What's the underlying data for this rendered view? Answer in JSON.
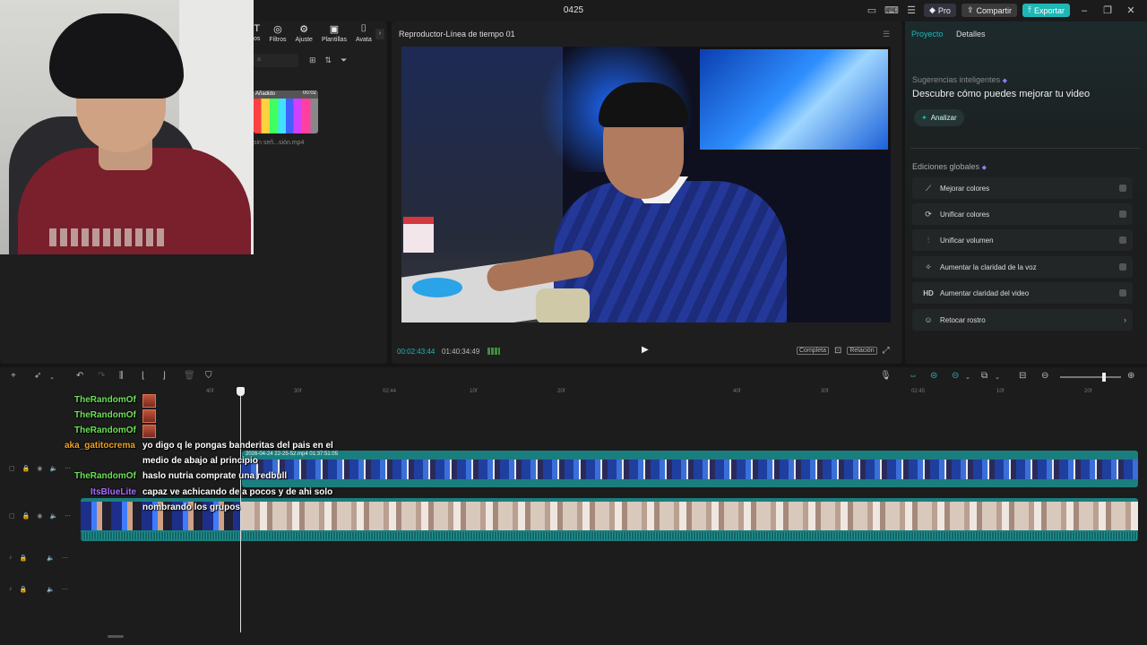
{
  "titlebar": {
    "title": "0425",
    "pro_label": "Pro",
    "share_label": "Compartir",
    "export_label": "Exportar"
  },
  "media_panel": {
    "tools": [
      {
        "label": "os",
        "icon": "text-icon"
      },
      {
        "label": "Filtros",
        "icon": "filters-icon"
      },
      {
        "label": "Ajuste",
        "icon": "adjust-icon"
      },
      {
        "label": "Plantillas",
        "icon": "templates-icon"
      },
      {
        "label": "Avata",
        "icon": "avatar-icon"
      }
    ],
    "search_placeholder": "a",
    "thumb_label": "Añadido",
    "thumb_duration": "00:02",
    "file_name": "sin señ...sión.mp4"
  },
  "player": {
    "title": "Reproductor-Línea de tiempo 01",
    "current_time": "00:02:43:44",
    "total_time": "01:40:34:49",
    "completa_label": "Completa",
    "relacion_label": "Relación"
  },
  "right_panel": {
    "tabs": [
      "Proyecto",
      "Detalles"
    ],
    "suggestions_label": "Sugerencias inteligentes",
    "suggestions_title": "Descubre cómo puedes mejorar tu video",
    "analyze_label": "Analizar",
    "global_label": "Ediciones globales",
    "global_items": [
      {
        "label": "Mejorar colores",
        "icon": "magic-wand-icon",
        "control": "toggle"
      },
      {
        "label": "Unificar colores",
        "icon": "color-match-icon",
        "control": "toggle"
      },
      {
        "label": "Unificar volumen",
        "icon": "volume-sliders-icon",
        "control": "toggle"
      },
      {
        "label": "Aumentar la claridad de la voz",
        "icon": "voice-clarity-icon",
        "control": "toggle"
      },
      {
        "label": "Aumentar claridad del video",
        "icon": "hd-icon",
        "control": "toggle"
      },
      {
        "label": "Retocar rostro",
        "icon": "face-retouch-icon",
        "control": "chevron"
      }
    ]
  },
  "timeline": {
    "ruler_labels": [
      "40f",
      "30f",
      "02:44",
      "10f",
      "20f",
      "40f",
      "30f",
      "02:45",
      "10f",
      "20f"
    ],
    "clip1_info": "2026-04-24 22-25-52.mp4   01:37:51:05"
  },
  "chat": [
    {
      "user": "TheRandomOf",
      "color": "green",
      "message": ""
    },
    {
      "user": "TheRandomOf",
      "color": "green",
      "message": ""
    },
    {
      "user": "TheRandomOf",
      "color": "green",
      "message": ""
    },
    {
      "user": "aka_gatitocrema",
      "color": "orange",
      "message": "yo digo q le pongas banderitas del pais en el",
      "message2": "medio de abajo al principio"
    },
    {
      "user": "TheRandomOf",
      "color": "green",
      "message": "haslo nutria comprate una redbull"
    },
    {
      "user": "ItsBlueLite",
      "color": "purple",
      "message": "capaz ve achicando de a pocos y de ahi solo",
      "message2": "nombrando los grupos"
    }
  ]
}
